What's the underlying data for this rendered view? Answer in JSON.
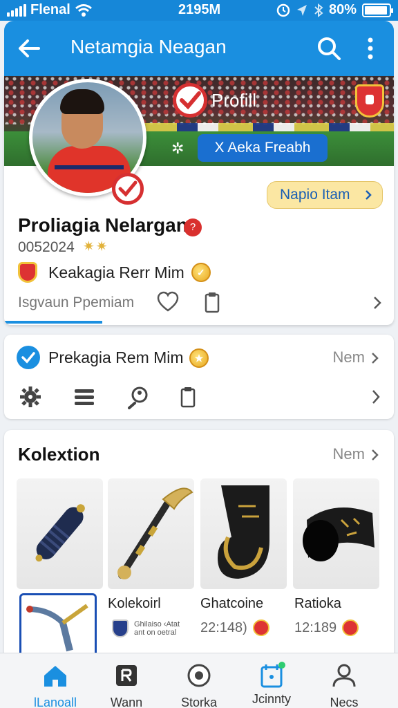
{
  "status_bar": {
    "carrier": "Flenal",
    "time": "2195M",
    "battery": "80%"
  },
  "app_bar": {
    "title": "Netamgia Neagan"
  },
  "banner": {
    "profill_label": "Profill",
    "feature_button": "X Aeka Freabh",
    "gold_button": "Napio Itam"
  },
  "profile": {
    "name": "Proliagia Nelargan",
    "badge": "?",
    "id": "0052024",
    "club_text": "Keakagia Rerr Mim",
    "action_text": "Isgvaun Ppemiam"
  },
  "card2": {
    "label": "Prekagia Rem Mim",
    "more": "Nem"
  },
  "collection": {
    "heading": "Kolextion",
    "more": "Nem",
    "items": [
      {
        "name": "Kolekoirl",
        "sub_line1": "Ghilaiso ‹Atat",
        "sub_line2": "ant on oetral"
      },
      {
        "name": "Ghatcoine",
        "sub": "22:148)"
      },
      {
        "name": "Ratioka",
        "sub": "12:189"
      }
    ]
  },
  "bottom_nav": [
    {
      "label": "lLanoall",
      "active": true
    },
    {
      "label": "Wann",
      "active": false
    },
    {
      "label": "Storka",
      "active": false
    },
    {
      "label": "Jcinnty",
      "active": false
    },
    {
      "label": "Necs",
      "active": false
    }
  ],
  "colors": {
    "primary": "#1a8fe0",
    "accent_red": "#d63031",
    "gold": "#fbe7a3"
  }
}
